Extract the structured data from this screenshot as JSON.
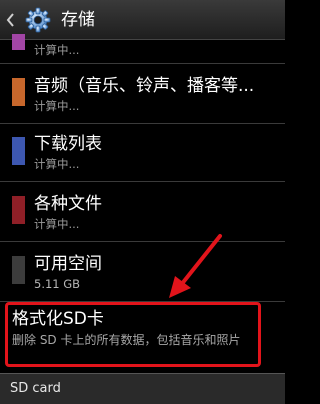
{
  "header": {
    "title": "存储",
    "back_icon": "chevron-left-icon",
    "settings_icon": "gear-icon"
  },
  "storage_items": [
    {
      "title": "",
      "subtitle": "计算中...",
      "color": "#a245a5"
    },
    {
      "title": "音频（音乐、铃声、播客等...",
      "subtitle": "计算中...",
      "color": "#c7672c"
    },
    {
      "title": "下载列表",
      "subtitle": "计算中...",
      "color": "#3d57b0"
    },
    {
      "title": "各种文件",
      "subtitle": "计算中...",
      "color": "#8f1f27"
    },
    {
      "title": "可用空间",
      "subtitle": "5.11 GB",
      "color": "#3c3c3c"
    }
  ],
  "format_sd": {
    "title": "格式化SD卡",
    "description": "删除 SD 卡上的所有数据，包括音乐和照片"
  },
  "footer": {
    "label": "SD card"
  },
  "colors": {
    "highlight": "#e2141b",
    "header_bg": "#2b2b2b"
  }
}
